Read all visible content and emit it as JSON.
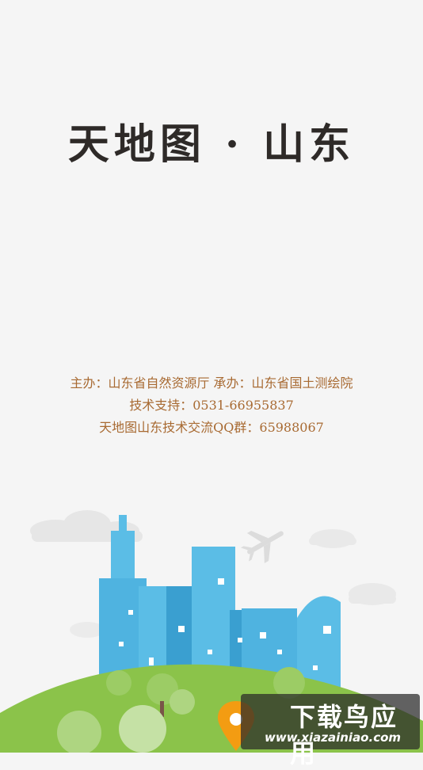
{
  "splash": {
    "title": "天地图 · 山东",
    "credits": [
      "主办：山东省自然资源厅   承办：山东省国土测绘院",
      "技术支持：0531-66955837",
      "天地图山东技术交流QQ群：65988067"
    ]
  },
  "watermark": {
    "name": "下载鸟应用",
    "url": "www.xiazainiao.com"
  },
  "colors": {
    "background": "#f5f5f5",
    "title": "#2e2a28",
    "credits": "#a86a32",
    "building_light": "#5bbde6",
    "building_dark": "#3a9fd0",
    "hill": "#8bc34a"
  }
}
